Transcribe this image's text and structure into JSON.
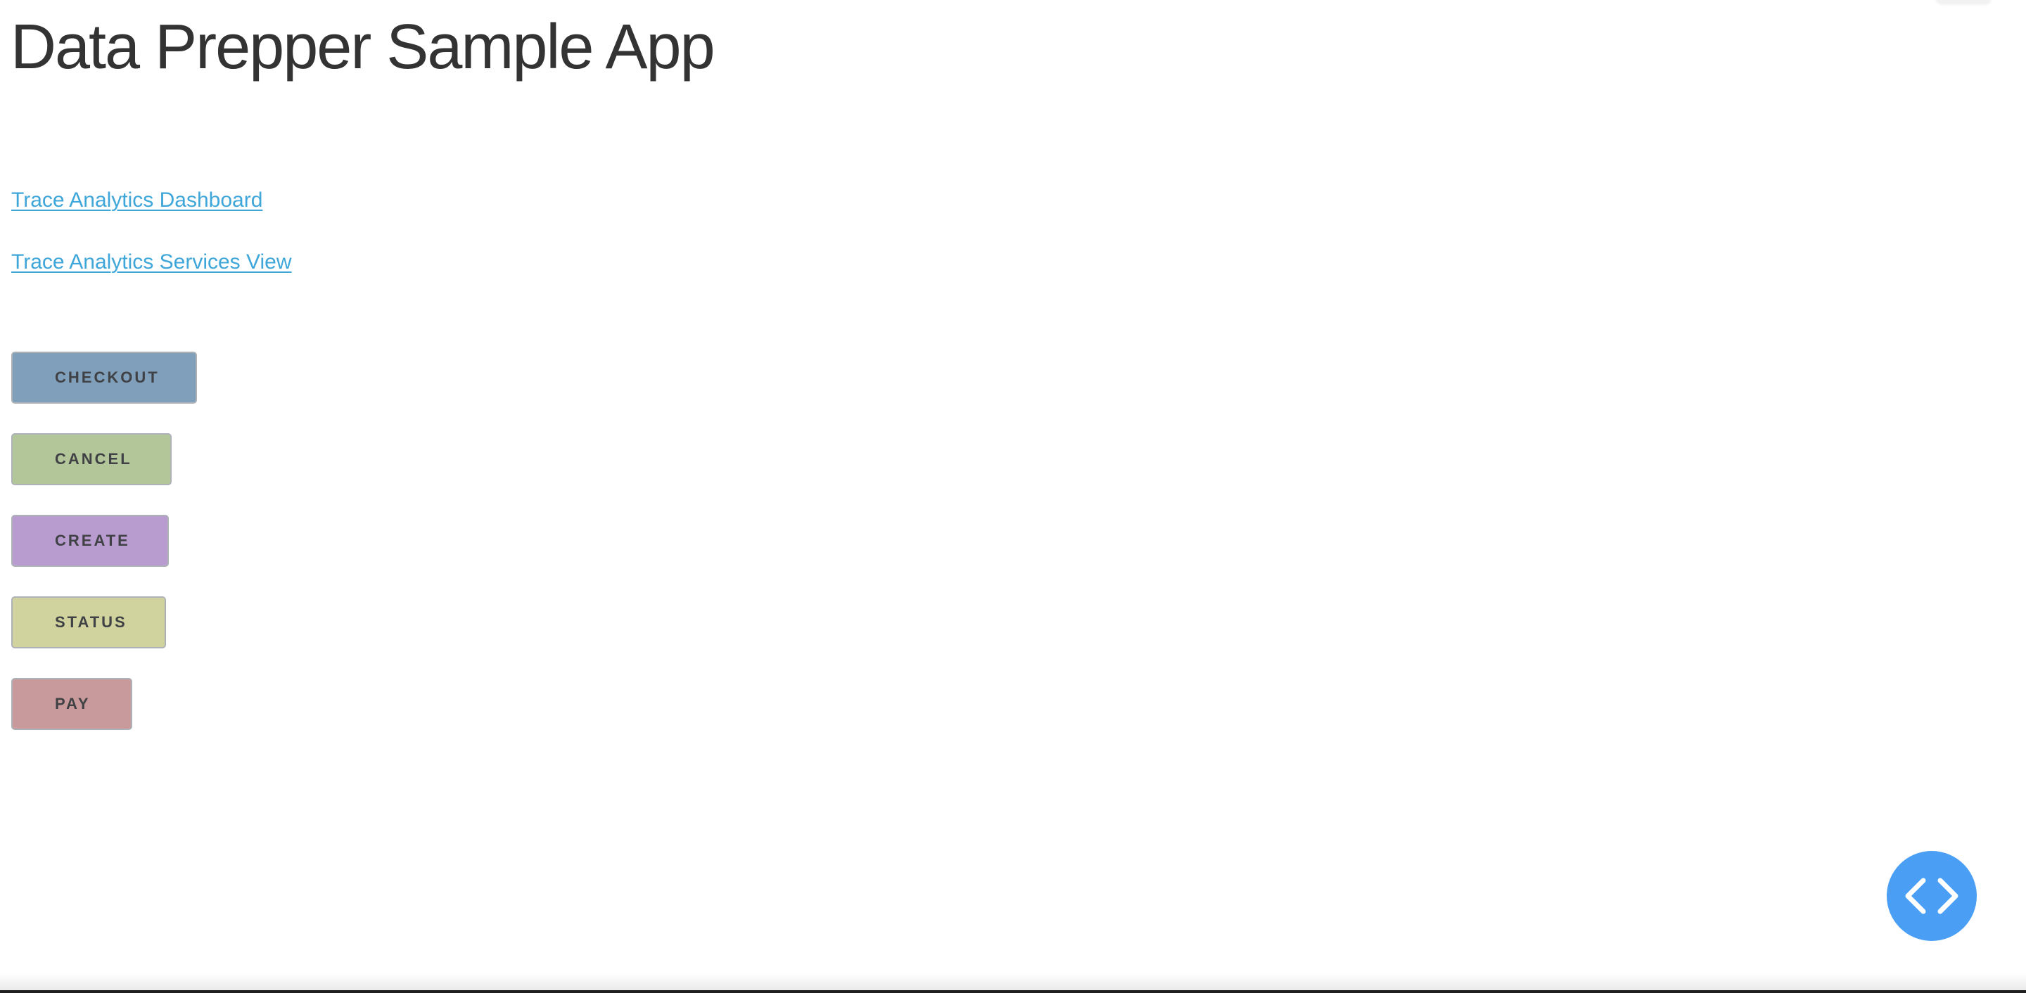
{
  "page": {
    "title": "Data Prepper Sample App"
  },
  "links": {
    "dashboard": "Trace Analytics Dashboard",
    "services_view": "Trace Analytics Services View"
  },
  "buttons": {
    "checkout": {
      "label": "CHECKOUT",
      "color": "#7f9fba"
    },
    "cancel": {
      "label": "CANCEL",
      "color": "#b3c699"
    },
    "create": {
      "label": "CREATE",
      "color": "#b89ccf"
    },
    "status": {
      "label": "STATUS",
      "color": "#d1d39e"
    },
    "pay": {
      "label": "PAY",
      "color": "#c99a9b"
    }
  },
  "colors": {
    "link": "#3ea6d8",
    "fab": "#4a9ff5"
  },
  "fab": {
    "icon": "code-brackets-icon"
  }
}
